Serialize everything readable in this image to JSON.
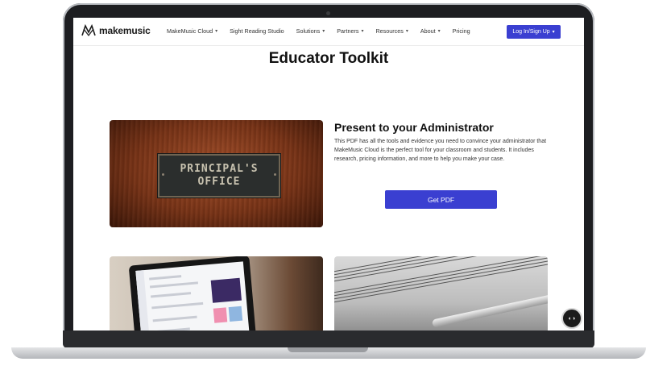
{
  "brand": {
    "name": "makemusic"
  },
  "nav": {
    "items": [
      {
        "label": "MakeMusic Cloud",
        "has_dropdown": true
      },
      {
        "label": "Sight Reading Studio",
        "has_dropdown": false
      },
      {
        "label": "Solutions",
        "has_dropdown": true
      },
      {
        "label": "Partners",
        "has_dropdown": true
      },
      {
        "label": "Resources",
        "has_dropdown": true
      },
      {
        "label": "About",
        "has_dropdown": true
      },
      {
        "label": "Pricing",
        "has_dropdown": false
      }
    ],
    "login_label": "Log In/Sign Up"
  },
  "page": {
    "title": "Educator Toolkit"
  },
  "feature": {
    "image_text_line1": "PRINCIPAL'S",
    "image_text_line2": "OFFICE",
    "heading": "Present to your Administrator",
    "body": "This PDF has all the tools and evidence you need to convince your administrator that MakeMusic Cloud is the perfect tool for your classroom and students. It includes research, pricing information, and more to help you make your case.",
    "button_label": "Get PDF"
  },
  "colors": {
    "accent": "#3a3fd1"
  },
  "icons": {
    "caption_button": "closed-caption-icon"
  }
}
